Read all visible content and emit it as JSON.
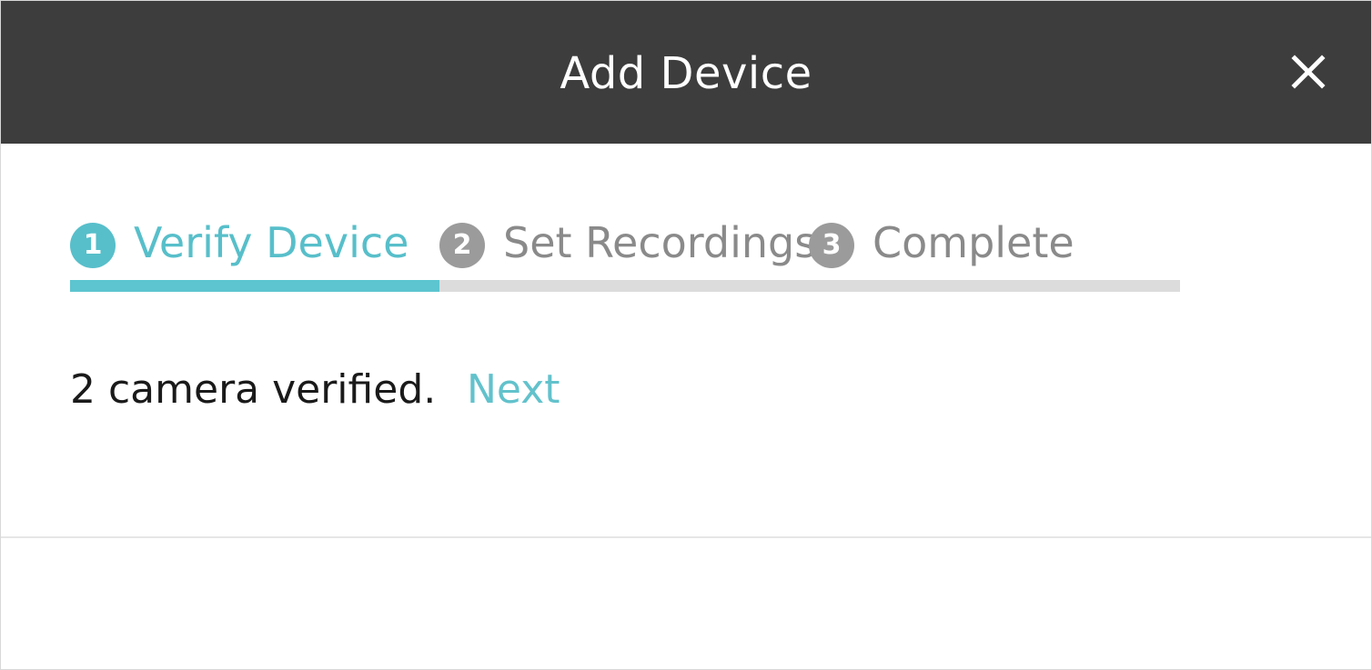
{
  "dialog": {
    "title": "Add Device",
    "close_icon": "close-icon"
  },
  "steps": [
    {
      "number": "1",
      "label": "Verify Device",
      "state": "active"
    },
    {
      "number": "2",
      "label": "Set Recordings",
      "state": "inactive"
    },
    {
      "number": "3",
      "label": "Complete",
      "state": "inactive"
    }
  ],
  "progress": {
    "current_step": 1,
    "total_steps": 3,
    "fraction": 0.333
  },
  "status": {
    "message": "2 camera verified.",
    "next_label": "Next"
  },
  "colors": {
    "accent": "#57bfca",
    "titlebar": "#3d3d3d",
    "inactive": "#9b9b9b",
    "track": "#dcdcdc"
  }
}
